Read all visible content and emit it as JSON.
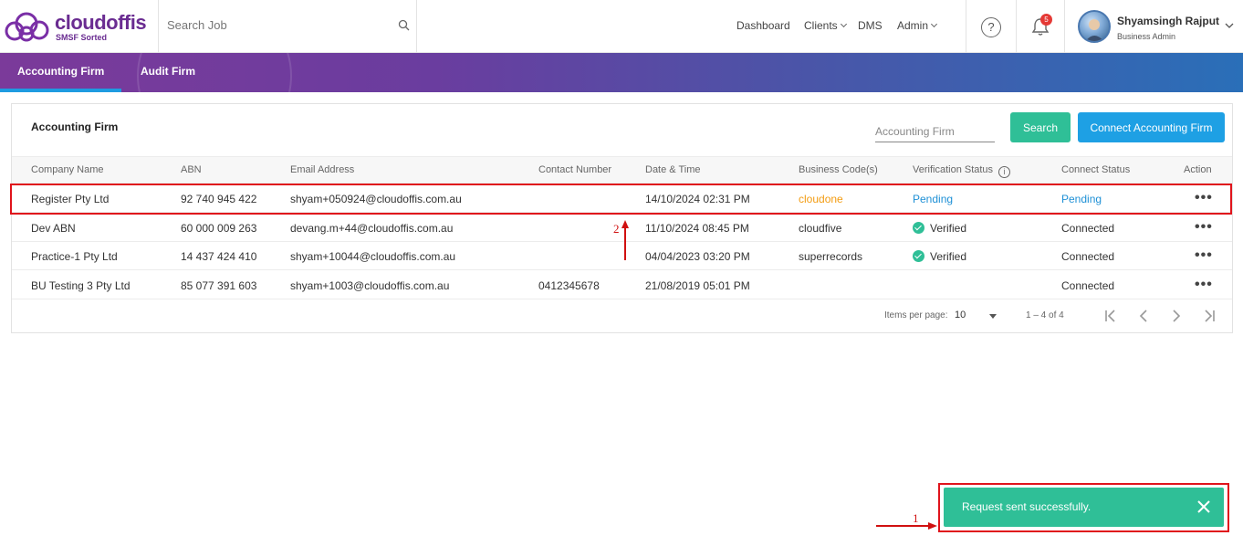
{
  "header": {
    "logo_text": "cloudoffis",
    "logo_sub": "SMSF Sorted",
    "search_placeholder": "Search Job",
    "nav": [
      "Dashboard",
      "Clients",
      "DMS",
      "Admin"
    ],
    "help_label": "?",
    "notification_count": "5",
    "user_name": "Shyamsingh Rajput",
    "user_role": "Business Admin"
  },
  "tabs": [
    {
      "label": "Accounting Firm",
      "active": true
    },
    {
      "label": "Audit Firm",
      "active": false
    }
  ],
  "card": {
    "title": "Accounting Firm",
    "filter_placeholder": "Accounting Firm",
    "search_button": "Search",
    "connect_button": "Connect Accounting Firm"
  },
  "table": {
    "columns": [
      "Company Name",
      "ABN",
      "Email Address",
      "Contact Number",
      "Date & Time",
      "Business Code(s)",
      "Verification Status",
      "Connect Status",
      "Action"
    ],
    "rows": [
      {
        "company": "Register Pty Ltd",
        "abn": "92 740 945 422",
        "email": "shyam+050924@cloudoffis.com.au",
        "contact": "",
        "datetime": "14/10/2024 02:31 PM",
        "code": "cloudone",
        "verification": "Pending",
        "connect": "Pending",
        "action": "•••"
      },
      {
        "company": "Dev ABN",
        "abn": "60 000 009 263",
        "email": "devang.m+44@cloudoffis.com.au",
        "contact": "",
        "datetime": "11/10/2024 08:45 PM",
        "code": "cloudfive",
        "verification": "Verified",
        "connect": "Connected",
        "action": "•••"
      },
      {
        "company": "Practice-1 Pty Ltd",
        "abn": "14 437 424 410",
        "email": "shyam+10044@cloudoffis.com.au",
        "contact": "",
        "datetime": "04/04/2023 03:20 PM",
        "code": "superrecords",
        "verification": "Verified",
        "connect": "Connected",
        "action": "•••"
      },
      {
        "company": "BU Testing 3 Pty Ltd",
        "abn": "85 077 391 603",
        "email": "shyam+1003@cloudoffis.com.au",
        "contact": "0412345678",
        "datetime": "21/08/2019 05:01 PM",
        "code": "",
        "verification": "",
        "connect": "Connected",
        "action": "•••"
      }
    ]
  },
  "pagination": {
    "items_per_page_label": "Items per page:",
    "items_per_page": "10",
    "range": "1 – 4 of 4"
  },
  "toast": {
    "message": "Request sent successfully."
  },
  "annotations": {
    "label_1": "1",
    "label_2": "2"
  },
  "colors": {
    "accent_green": "#2fbf97",
    "accent_blue": "#1ea0e4",
    "brand_purple": "#6a2c91",
    "pending_orange": "#f39c12",
    "annotation_red": "#e0141c"
  }
}
